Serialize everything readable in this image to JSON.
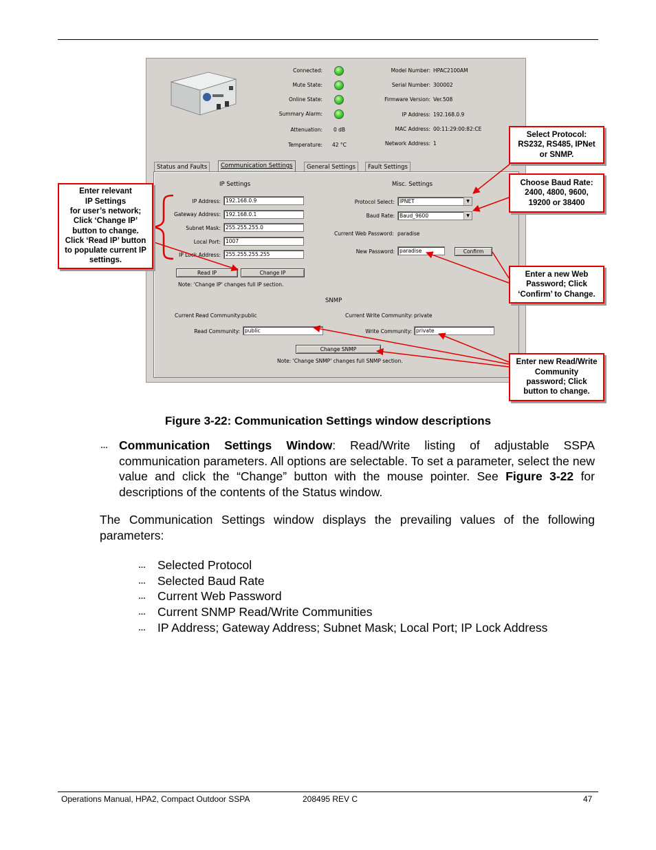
{
  "window": {
    "status": {
      "connected_label": "Connected:",
      "mute_label": "Mute State:",
      "online_label": "Online State:",
      "summary_label": "Summary Alarm:",
      "attenuation_label": "Attenuation:",
      "attenuation_value": "0 dB",
      "temperature_label": "Temperature:",
      "temperature_value": "42 °C",
      "model_label": "Model Number:",
      "model_value": "HPAC2100AM",
      "serial_label": "Serial Number:",
      "serial_value": "300002",
      "firmware_label": "Firmware Version:",
      "firmware_value": "Ver.508",
      "ip_label": "IP Address:",
      "ip_value": "192.168.0.9",
      "mac_label": "MAC Address:",
      "mac_value": "00:11:29:00:82:CE",
      "network_label": "Network Address:",
      "network_value": "1"
    },
    "tabs": [
      "Status and Faults",
      "Communication Settings",
      "General Settings",
      "Fault Settings"
    ],
    "ip_settings": {
      "heading": "IP Settings",
      "ip_label": "IP Address:",
      "ip_value": "192.168.0.9",
      "gateway_label": "Gateway Address:",
      "gateway_value": "192.168.0.1",
      "subnet_label": "Subnet Mask:",
      "subnet_value": "255.255.255.0",
      "port_label": "Local Port:",
      "port_value": "1007",
      "lock_label": "IP Lock Address:",
      "lock_value": "255.255.255.255",
      "read_ip_button": "Read IP",
      "change_ip_button": "Change IP",
      "note": "Note: 'Change IP' changes full IP section."
    },
    "misc_settings": {
      "heading": "Misc. Settings",
      "protocol_label": "Protocol Select:",
      "protocol_value": "IPNET",
      "baud_label": "Baud Rate:",
      "baud_value": "Baud_9600",
      "current_pw_label": "Current Web Password:",
      "current_pw_value": "paradise",
      "new_pw_label": "New Password:",
      "new_pw_value": "paradise",
      "confirm_button": "Confirm"
    },
    "snmp": {
      "heading": "SNMP",
      "current_read_label": "Current Read Community:",
      "current_read_value": "public",
      "current_write_label": "Current Write Community:",
      "current_write_value": "private",
      "read_label": "Read Community:",
      "read_value": "public",
      "write_label": "Write Community:",
      "write_value": "private",
      "change_button": "Change SNMP",
      "note": "Note: 'Change SNMP' changes full SNMP section."
    }
  },
  "callouts": {
    "ip": [
      "Enter relevant",
      "IP Settings",
      "for user’s network;",
      "Click ‘Change IP’",
      "button to change.",
      "Click ‘Read IP’ button",
      "to populate current IP",
      "settings."
    ],
    "protocol": [
      "Select Protocol:",
      "RS232, RS485, IPNet",
      "or SNMP."
    ],
    "baud": [
      "Choose Baud Rate:",
      "2400, 4800, 9600,",
      "19200 or 38400"
    ],
    "password": [
      "Enter a new Web",
      "Password; Click",
      "‘Confirm’ to Change."
    ],
    "community": [
      "Enter new Read/Write",
      "Community",
      "password; Click",
      "button to change."
    ]
  },
  "caption": "Figure 3-22: Communication Settings window descriptions",
  "body": {
    "bullet_glyph": "…",
    "p1_bold": "Communication Settings Window",
    "p1_text": ": Read/Write listing of adjustable SSPA communication parameters. All options are selectable. To set a parameter, select the new value and click the “Change” button with the mouse pointer. See ",
    "p1_ref": "Figure 3-22",
    "p1_end": " for descriptions of the contents of the Status window.",
    "p2": "The Communication Settings window displays the prevailing values of the following parameters:",
    "items": [
      "Selected Protocol",
      "Selected Baud Rate",
      "Current Web Password",
      "Current SNMP Read/Write Communities",
      "IP Address; Gateway Address; Subnet Mask; Local Port; IP Lock Address"
    ]
  },
  "footer": {
    "left": "Operations Manual, HPA2, Compact Outdoor SSPA",
    "center": "208495 REV C",
    "page": "47"
  },
  "colors": {
    "callout_border": "#e00000",
    "led": "#4fd13c",
    "window_bg": "#d6d3ce"
  }
}
